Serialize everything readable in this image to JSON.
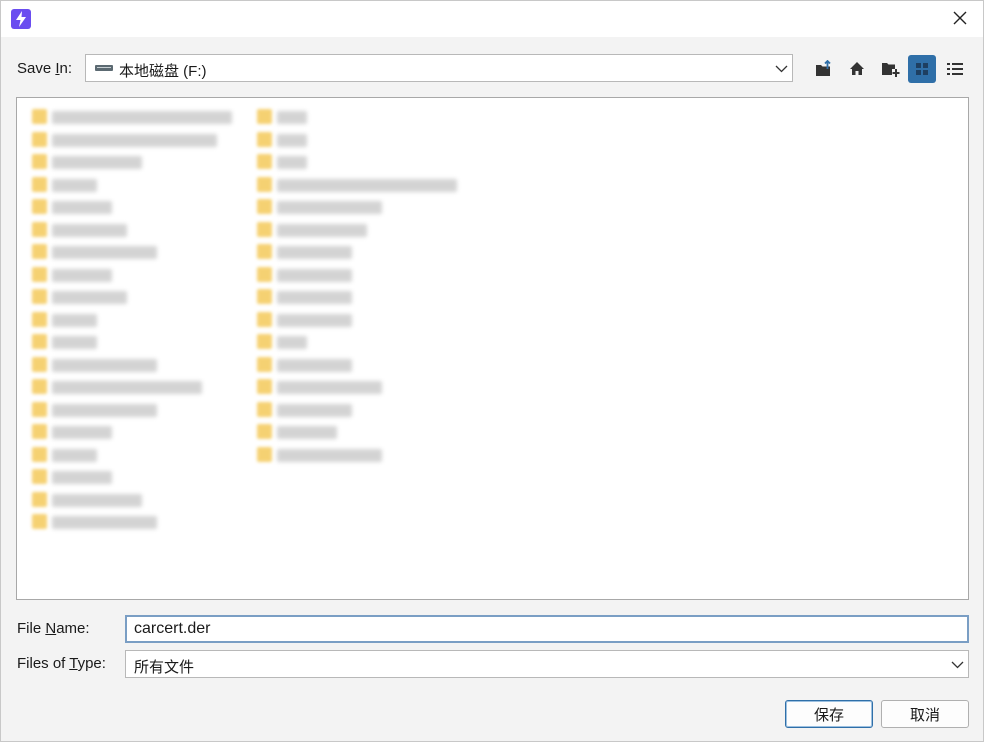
{
  "dialog": {
    "save_in_label_pre": "Save ",
    "save_in_label_mnemonic": "I",
    "save_in_label_post": "n:",
    "location": "本地磁盘 (F:)",
    "file_name_label_pre": "File ",
    "file_name_label_mnemonic": "N",
    "file_name_label_post": "ame:",
    "file_name_value": "carcert.der",
    "files_of_type_label_pre": "Files of ",
    "files_of_type_label_mnemonic": "T",
    "files_of_type_label_post": "ype:",
    "file_type_value": "所有文件",
    "save_label": "保存",
    "cancel_label": "取消"
  },
  "toolbar": {
    "icons": [
      "up-folder-icon",
      "home-icon",
      "new-folder-icon",
      "list-view-icon",
      "details-view-icon"
    ],
    "accent_color": "#2f6fa8"
  },
  "app": {
    "icon": "lightning-app-icon",
    "icon_color": "#6a4df0"
  },
  "file_list": {
    "note_visible": "file names blurred"
  }
}
